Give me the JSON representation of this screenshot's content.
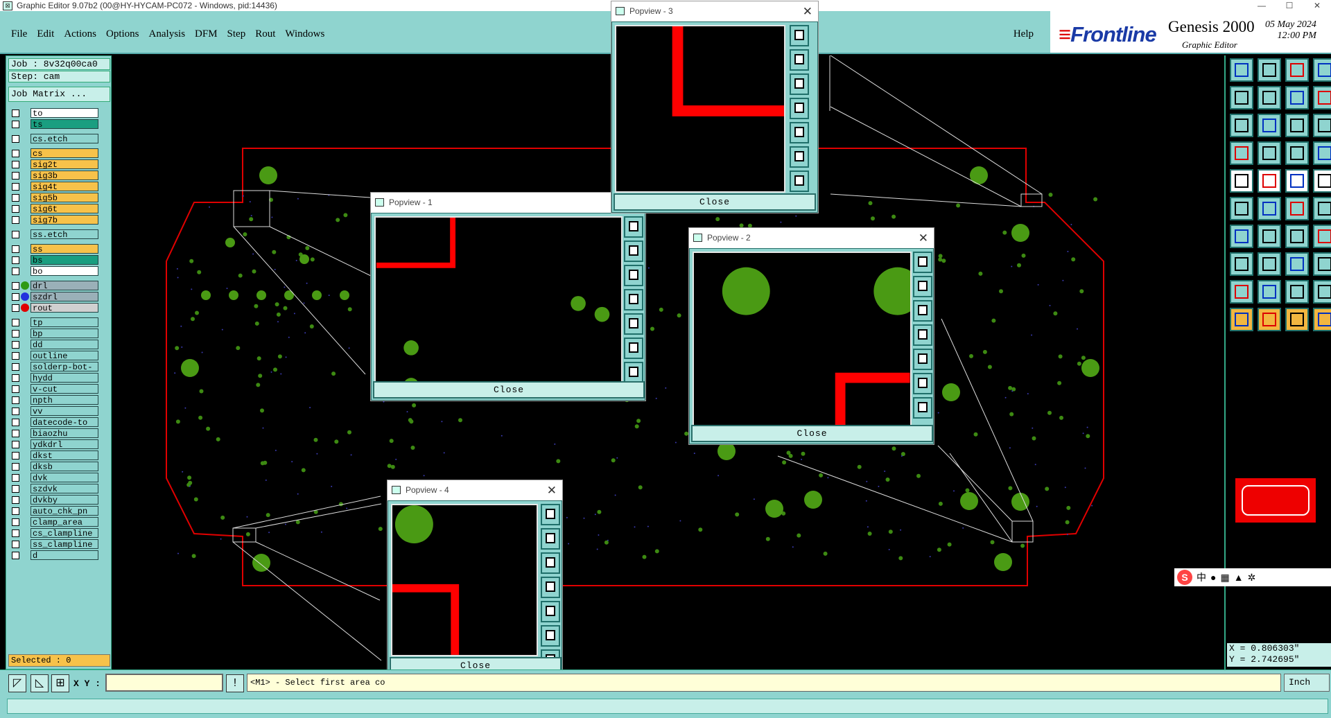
{
  "window": {
    "title": "Graphic Editor 9.07b2 (00@HY-HYCAM-PC072 - Windows, pid:14436)",
    "min": "—",
    "max": "☐",
    "close": "✕"
  },
  "menu": {
    "items": [
      "File",
      "Edit",
      "Actions",
      "Options",
      "Analysis",
      "DFM",
      "Step",
      "Rout",
      "Windows"
    ],
    "help": "Help"
  },
  "brand": {
    "logo_a": "≡",
    "logo_b": "Frontline",
    "product": "Genesis 2000",
    "sub": "Graphic Editor",
    "date": "05 May 2024",
    "time": "12:00 PM"
  },
  "left": {
    "job": "Job : 8v32q00ca0",
    "step": "Step: cam",
    "matrix_btn": "Job Matrix ...",
    "selected": "Selected : 0"
  },
  "layers": [
    {
      "name": "to",
      "color": "#ffffff"
    },
    {
      "name": "ts",
      "color": "#1a9e80"
    },
    {
      "gap": true
    },
    {
      "name": "cs.etch",
      "color": "#8fd4cf"
    },
    {
      "gap": true
    },
    {
      "name": "cs",
      "color": "#f7c24a"
    },
    {
      "name": "sig2t",
      "color": "#f7c24a"
    },
    {
      "name": "sig3b",
      "color": "#f7c24a"
    },
    {
      "name": "sig4t",
      "color": "#f7c24a"
    },
    {
      "name": "sig5b",
      "color": "#f7c24a"
    },
    {
      "name": "sig6t",
      "color": "#f7c24a"
    },
    {
      "name": "sig7b",
      "color": "#f7c24a"
    },
    {
      "gap": true
    },
    {
      "name": "ss.etch",
      "color": "#8fd4cf"
    },
    {
      "gap": true
    },
    {
      "name": "ss",
      "color": "#f7c24a"
    },
    {
      "name": "bs",
      "color": "#1a9e80"
    },
    {
      "name": "bo",
      "color": "#ffffff"
    },
    {
      "gap": true
    },
    {
      "name": "drl",
      "color": "#9ab0b8",
      "dot": "#2e9a14"
    },
    {
      "name": "szdrl",
      "color": "#9ab0b8",
      "dot": "#2233dd"
    },
    {
      "name": "rout",
      "color": "#d0d0d0",
      "dot": "#e00000"
    },
    {
      "gap": true
    },
    {
      "name": "tp",
      "color": "#8fd4cf"
    },
    {
      "name": "bp",
      "color": "#8fd4cf"
    },
    {
      "name": "dd",
      "color": "#8fd4cf"
    },
    {
      "name": "outline",
      "color": "#8fd4cf"
    },
    {
      "name": "solderp-bot-",
      "color": "#8fd4cf"
    },
    {
      "name": "hydd",
      "color": "#8fd4cf"
    },
    {
      "name": "v-cut",
      "color": "#8fd4cf"
    },
    {
      "name": "npth",
      "color": "#8fd4cf"
    },
    {
      "name": "vv",
      "color": "#8fd4cf"
    },
    {
      "name": "datecode-to",
      "color": "#8fd4cf"
    },
    {
      "name": "biaozhu",
      "color": "#8fd4cf"
    },
    {
      "name": "ydkdrl",
      "color": "#8fd4cf"
    },
    {
      "name": "dkst",
      "color": "#8fd4cf"
    },
    {
      "name": "dksb",
      "color": "#8fd4cf"
    },
    {
      "name": "dvk",
      "color": "#8fd4cf"
    },
    {
      "name": "szdvk",
      "color": "#8fd4cf"
    },
    {
      "name": "dvkby",
      "color": "#8fd4cf"
    },
    {
      "name": "auto_chk_pn",
      "color": "#8fd4cf"
    },
    {
      "name": "clamp_area",
      "color": "#8fd4cf"
    },
    {
      "name": "cs_clampline",
      "color": "#8fd4cf"
    },
    {
      "name": "ss_clampline",
      "color": "#8fd4cf"
    },
    {
      "name": "d",
      "color": "#8fd4cf"
    }
  ],
  "popups": [
    {
      "title": "Popview - 1",
      "close": "Close"
    },
    {
      "title": "Popview - 2",
      "close": "Close"
    },
    {
      "title": "Popview - 3",
      "close": "Close"
    },
    {
      "title": "Popview - 4",
      "close": "Close"
    }
  ],
  "status": {
    "xy_label": "X Y :",
    "prompt": "<M1> - Select first area co",
    "units": "Inch"
  },
  "coords": {
    "x": "X = 0.806303\"",
    "y": "Y = 2.742695\""
  },
  "ime": {
    "label": "中"
  },
  "colors": {
    "teal": "#8fd4cf",
    "outline_red": "#e00000",
    "pad_green": "#4a9a14",
    "trace_red": "#ff0000"
  }
}
